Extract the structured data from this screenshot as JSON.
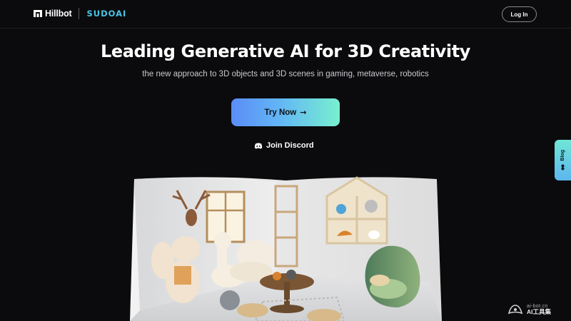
{
  "header": {
    "brand_name": "Hillbot",
    "partner_name": "SUDOAI",
    "login_label": "Log In"
  },
  "hero": {
    "title": "Leading Generative AI for 3D Creativity",
    "subtitle": "the new approach to 3D objects and 3D scenes in gaming, metaverse, robotics",
    "cta_label": "Try Now",
    "cta_icon": "arrow-right-icon",
    "discord_label": "Join Discord",
    "discord_icon": "discord-icon"
  },
  "side_tab": {
    "label": "Blog",
    "icon": "blog-icon"
  },
  "showcase": {
    "image": "3d-room-scene-preview"
  },
  "watermark": {
    "domain": "ai-bot.cn",
    "brand": "AI工具集"
  },
  "colors": {
    "background": "#0b0b0d",
    "accent_blue": "#5b8cf7",
    "accent_teal": "#78f0cf",
    "sudo_blue": "#49c3e6"
  }
}
